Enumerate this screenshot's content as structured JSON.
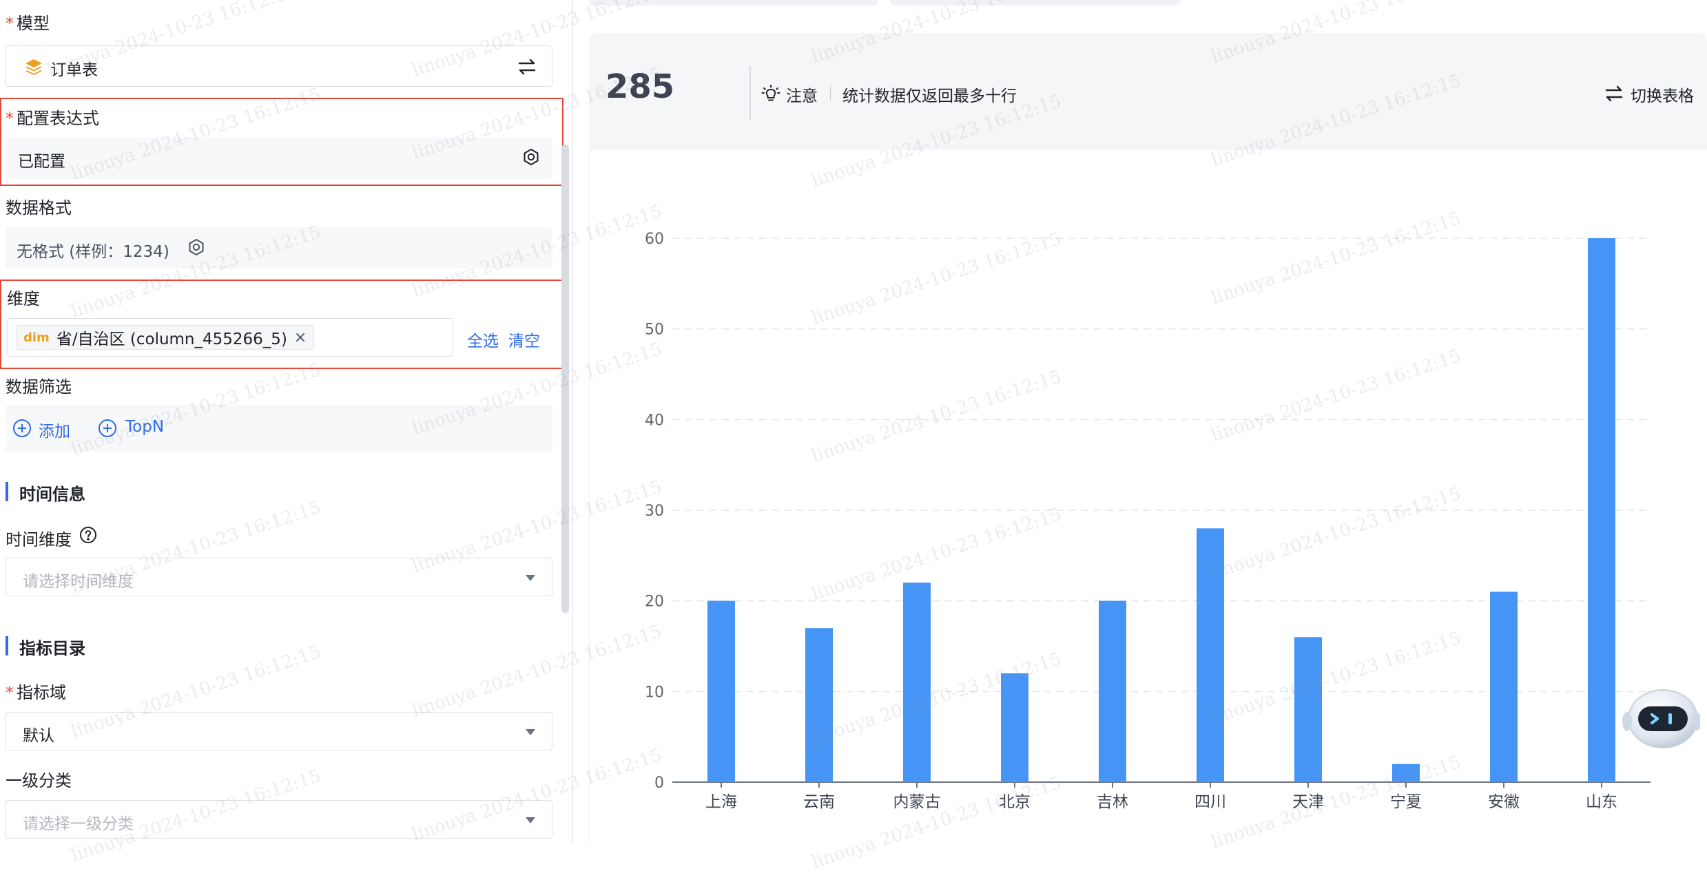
{
  "left_panel": {
    "model": {
      "label": "模型",
      "value": "订单表"
    },
    "expression": {
      "label": "配置表达式",
      "value": "已配置"
    },
    "data_format": {
      "label": "数据格式",
      "value": "无格式 (样例：1234)"
    },
    "dimension": {
      "label": "维度",
      "tag_prefix": "dim",
      "tag_text": "省/自治区 (column_455266_5)",
      "select_all": "全选",
      "clear": "清空"
    },
    "data_filter": {
      "label": "数据筛选",
      "add": "添加",
      "topn": "TopN"
    },
    "time_info": {
      "section": "时间信息",
      "time_dimension_label": "时间维度",
      "time_dimension_placeholder": "请选择时间维度"
    },
    "metric_catalog": {
      "section": "指标目录",
      "metric_domain_label": "指标域",
      "metric_domain_value": "默认",
      "level1_label": "一级分类",
      "level1_placeholder": "请选择一级分类"
    }
  },
  "stats": {
    "count": "285",
    "notice_label": "注意",
    "notice_text": "统计数据仅返回最多十行",
    "toggle_label": "切换表格"
  },
  "watermark_text": "linouya 2024-10-23 16:12:15",
  "colors": {
    "accent": "#2f6bea",
    "bar": "#4694f5",
    "required": "#e5483b",
    "model_icon": "#f0a020"
  },
  "chart_data": {
    "type": "bar",
    "categories": [
      "上海",
      "云南",
      "内蒙古",
      "北京",
      "吉林",
      "四川",
      "天津",
      "宁夏",
      "安徽",
      "山东"
    ],
    "values": [
      20,
      17,
      22,
      12,
      20,
      28,
      16,
      2,
      21,
      60
    ],
    "ylim": [
      0,
      60
    ],
    "yticks": [
      0,
      10,
      20,
      30,
      40,
      50,
      60
    ],
    "grid": true,
    "title": "",
    "xlabel": "",
    "ylabel": ""
  }
}
